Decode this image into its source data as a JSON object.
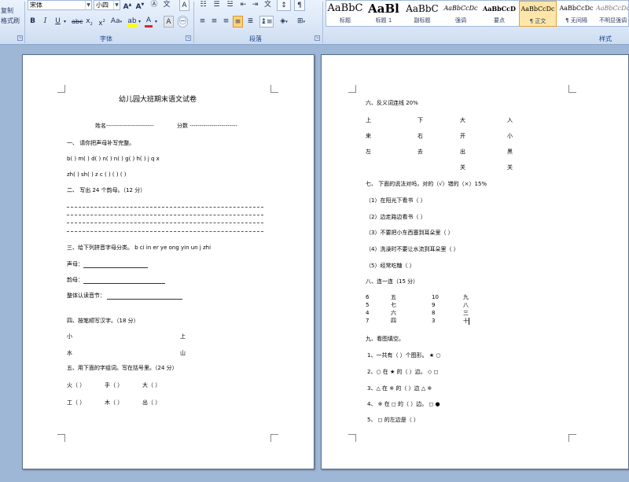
{
  "ribbon": {
    "clipboard": {
      "copy": "复制",
      "format_painter": "格式刷"
    },
    "font": {
      "name": "宋体",
      "size": "小四",
      "group_label": "字体"
    },
    "paragraph": {
      "group_label": "段落"
    },
    "styles": {
      "group_label": "样式",
      "items": [
        {
          "preview": "AaBbC",
          "name": "标题"
        },
        {
          "preview": "AaBl",
          "name": "标题 1"
        },
        {
          "preview": "AaBbC",
          "name": "副标题"
        },
        {
          "preview": "AaBbCcDc",
          "name": "强调"
        },
        {
          "preview": "AaBbCcD",
          "name": "要点"
        },
        {
          "preview": "AaBbCcDc",
          "name": "正文"
        },
        {
          "preview": "AaBbCcDc",
          "name": "无间隔"
        },
        {
          "preview": "AaBbCcDc",
          "name": "不明显强调"
        }
      ]
    }
  },
  "page1": {
    "title": "幼儿园大班期末语文试卷",
    "name_field": "姓名------------------------",
    "score_field": "分数 ------------------------",
    "q1": "一、   请你把声母补写完整。",
    "q1_row1": "b(  )    m(  )     d(  )   n(  )     n(  )      g(  )     h(  )   j   q   x",
    "q1_row2": "zh(  )   sh(  )    z   c   (   )    (   )   (   )",
    "q2": "二、   写出 24 个韵母。（12 分）",
    "q3": "三、给下列拼音字母分类。  b    ci    in    er    ye    ong    yin    un    j     zhi",
    "q3_a": "声母：",
    "q3_b": "韵母：",
    "q3_c": "整体认读音节：",
    "q4": "四、按笔顺写汉字。（18 分）",
    "q4_w1": "小",
    "q4_w2": "上",
    "q4_w3": "水",
    "q4_w4": "山",
    "q5": "五、用下面的字组词。写在括号里。（24 分）",
    "q5_r1c1": "火（     ）",
    "q5_r1c2": "手（     ）",
    "q5_r1c3": "大（     ）",
    "q5_r2c1": "工（     ）",
    "q5_r2c2": "木（     ）",
    "q5_r2c3": "出（     ）"
  },
  "page2": {
    "q6": "六、反义词连线 20%",
    "q6_rows": [
      [
        "上",
        "下",
        "大",
        "入"
      ],
      [
        "来",
        "右",
        "开",
        "小"
      ],
      [
        "左",
        "去",
        "出",
        "黑"
      ],
      [
        "",
        "",
        "关",
        "关"
      ]
    ],
    "q7": "七、     下面的说法对吗，对的（√）错的（×）15%",
    "q7_items": [
      "（1）在阳光下看书（     ）",
      "（2）边走路边看书（     ）",
      "（3）不要把小东西塞到耳朵里（       ）",
      "（4）洗澡时不要让水流到耳朵里（       ）",
      "（5）经常吃糖（       ）"
    ],
    "q8": "八、连一连（15 分）",
    "q8_rows": [
      [
        "6",
        "五",
        "10",
        "九"
      ],
      [
        "5",
        "七",
        "9",
        "八"
      ],
      [
        "4",
        "六",
        "8",
        "三"
      ],
      [
        "7",
        "四",
        "3",
        "十"
      ]
    ],
    "q9": "九、看图填空。",
    "q9_items": [
      "1、一共有（       ）个图形。        ★  ○",
      "2、○ 在  ★      的（       ）边。 ◇  ◻",
      "3、△   在  ※  的（       ）边       △  ※",
      "4、 ※   在   ◻ 的（       ）边。 ◻  ●",
      "5、   ◻   的左边是（       ）"
    ]
  }
}
